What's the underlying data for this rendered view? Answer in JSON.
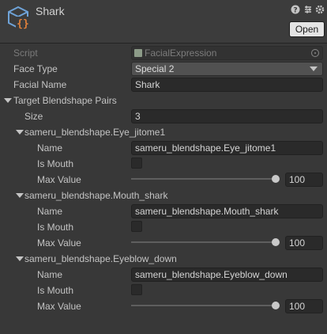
{
  "header": {
    "title": "Shark",
    "open_label": "Open",
    "icons": [
      "script-file-icon",
      "help-icon",
      "preset-icon",
      "settings-icon"
    ]
  },
  "fields": {
    "script_label": "Script",
    "script_value": "FacialExpression",
    "face_type_label": "Face Type",
    "face_type_value": "Special 2",
    "facial_name_label": "Facial Name",
    "facial_name_value": "Shark",
    "target_label": "Target Blendshape Pairs",
    "size_label": "Size",
    "size_value": "3"
  },
  "pairs": [
    {
      "header": "sameru_blendshape.Eye_jitome1",
      "name_label": "Name",
      "name_value": "sameru_blendshape.Eye_jitome1",
      "is_mouth_label": "Is Mouth",
      "is_mouth": false,
      "max_value_label": "Max Value",
      "max_value": "100",
      "slider_fraction": 1.0
    },
    {
      "header": "sameru_blendshape.Mouth_shark",
      "name_label": "Name",
      "name_value": "sameru_blendshape.Mouth_shark",
      "is_mouth_label": "Is Mouth",
      "is_mouth": false,
      "max_value_label": "Max Value",
      "max_value": "100",
      "slider_fraction": 1.0
    },
    {
      "header": "sameru_blendshape.Eyeblow_down",
      "name_label": "Name",
      "name_value": "sameru_blendshape.Eyeblow_down",
      "is_mouth_label": "Is Mouth",
      "is_mouth": false,
      "max_value_label": "Max Value",
      "max_value": "100",
      "slider_fraction": 1.0
    }
  ],
  "colors": {
    "background": "#383838",
    "field_bg": "#2a2a2a",
    "button_bg": "#e4e4e4",
    "icon_blue": "#6fa3d8",
    "icon_orange": "#e0803a"
  }
}
